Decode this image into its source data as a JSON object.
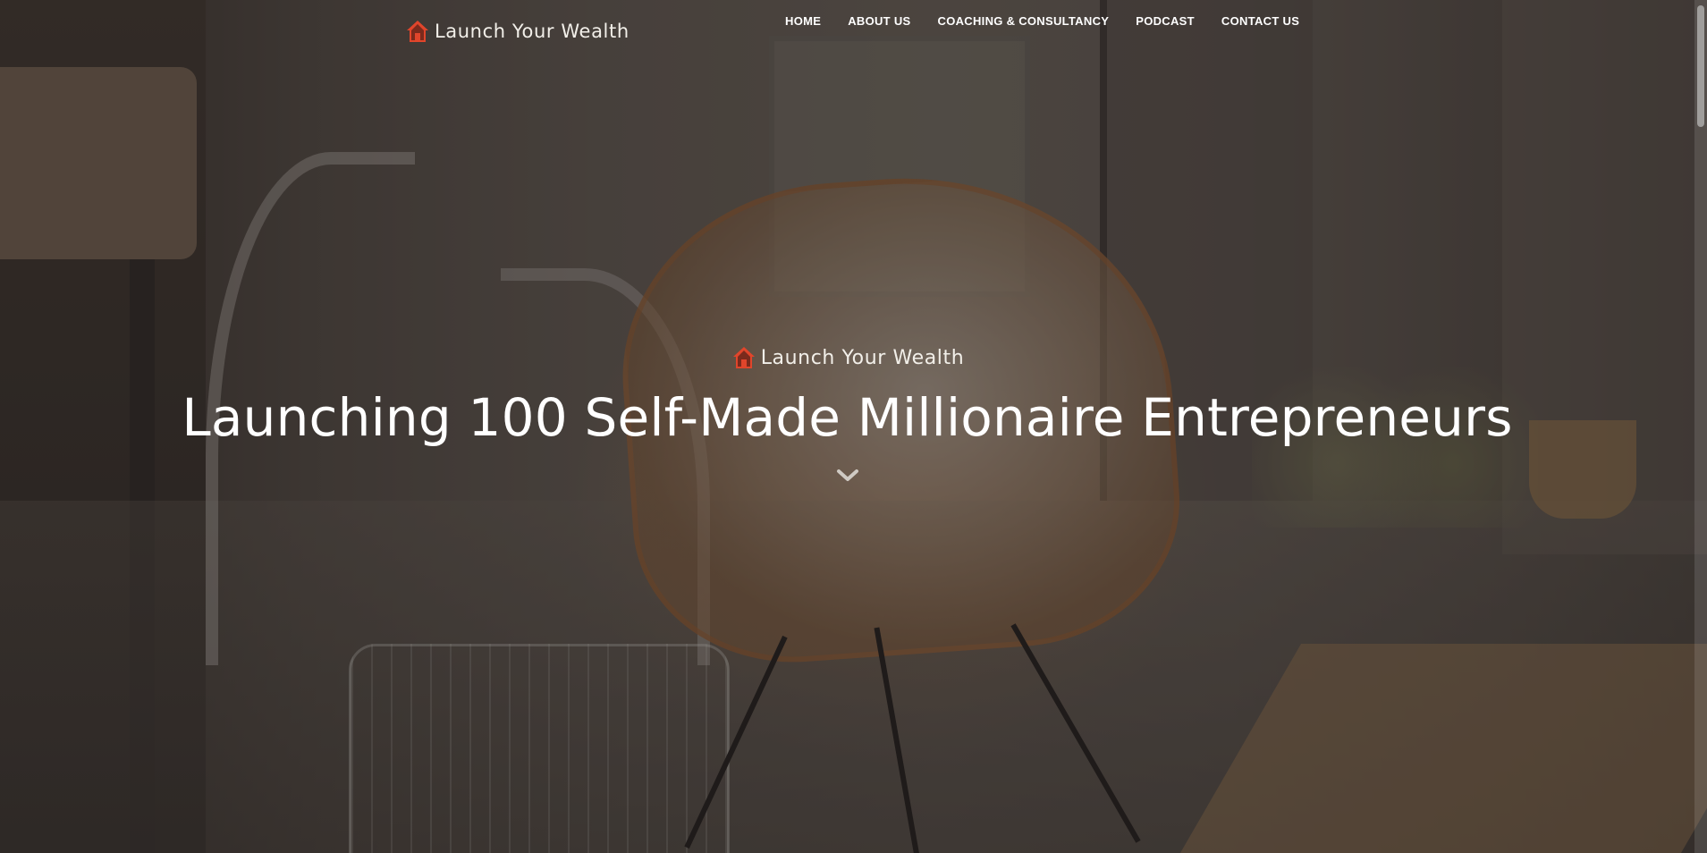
{
  "header": {
    "brand": "Launch Your Wealth",
    "nav": [
      {
        "label": "HOME"
      },
      {
        "label": "ABOUT US"
      },
      {
        "label": "COACHING & CONSULTANCY"
      },
      {
        "label": "PODCAST"
      },
      {
        "label": "CONTACT US"
      }
    ]
  },
  "hero": {
    "brand": "Launch Your Wealth",
    "title": "Launching 100 Self-Made Millionaire Entrepreneurs",
    "scroll_icon": "chevron-down-icon"
  },
  "colors": {
    "brand_icon": "#e0452b",
    "text": "#ffffff"
  }
}
